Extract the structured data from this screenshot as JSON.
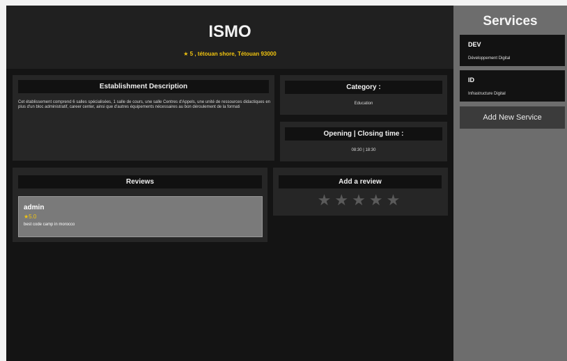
{
  "header": {
    "title": "ISMO",
    "rating_star": "★",
    "address": "5 , tétouan shore, Tétouan 93000"
  },
  "description": {
    "heading": "Establishment Description",
    "text": "Cet établissement comprend 6 salles spécialisées, 1 salle de cours, une salle Centres d'Appels, une unité de ressources didactiques en plus d'un bloc administratif, career center, ainsi que d'autres équipements nécessaires au bon déroulement de la formati"
  },
  "category": {
    "heading": "Category :",
    "value": "Education"
  },
  "hours": {
    "heading": "Opening | Closing time :",
    "value": "08:30 | 18:30"
  },
  "reviews": {
    "heading": "Reviews",
    "items": [
      {
        "user": "admin",
        "rating": "★5.0",
        "text": "best code camp in morocco"
      }
    ]
  },
  "add_review": {
    "heading": "Add a review",
    "stars": [
      "★",
      "★",
      "★",
      "★",
      "★"
    ]
  },
  "services": {
    "title": "Services",
    "items": [
      {
        "code": "DEV",
        "name": "Développement Digital"
      },
      {
        "code": "ID",
        "name": "Infrastructure Digital"
      }
    ],
    "add_label": "Add New Service"
  },
  "colors": {
    "accent": "#f1c40f",
    "background": "#141414",
    "sidebar": "#6d6d6d"
  }
}
